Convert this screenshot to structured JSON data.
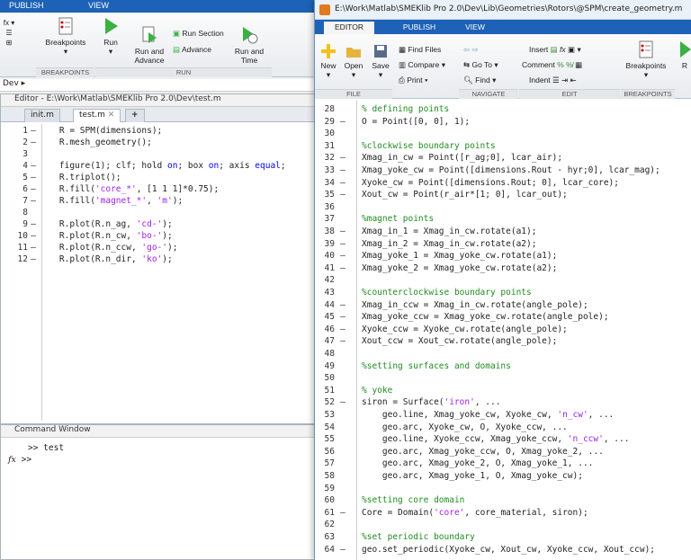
{
  "back_window": {
    "tabs": [
      "PUBLISH",
      "VIEW"
    ],
    "ribbon": {
      "breakpoints_label": "Breakpoints",
      "run_label": "Run",
      "run_and_advance_label": "Run and\nAdvance",
      "run_section_label": "Run Section",
      "advance_label": "Advance",
      "run_and_time_label": "Run and\nTime",
      "group_breakpoints": "BREAKPOINTS",
      "group_run": "RUN"
    },
    "address": "Dev ▸",
    "editor": {
      "title": "Editor - E:\\Work\\Matlab\\SMEKlib Pro 2.0\\Dev\\test.m",
      "tabs": [
        "init.m",
        "test.m",
        "+"
      ],
      "lines": [
        {
          "n": "1",
          "t": "    R = SPM(dimensions);"
        },
        {
          "n": "2",
          "t": "    R.mesh_geometry();"
        },
        {
          "n": "3",
          "t": ""
        },
        {
          "n": "4",
          "t": "    figure(1); clf; hold on; box on; axis equal;"
        },
        {
          "n": "5",
          "t": "    R.triplot();"
        },
        {
          "n": "6",
          "t": "    R.fill('core_*', [1 1 1]*0.75);"
        },
        {
          "n": "7",
          "t": "    R.fill('magnet_*', 'm');"
        },
        {
          "n": "8",
          "t": ""
        },
        {
          "n": "9",
          "t": "    R.plot(R.n_ag, 'cd-');"
        },
        {
          "n": "10",
          "t": "    R.plot(R.n_cw, 'bo-');"
        },
        {
          "n": "11",
          "t": "    R.plot(R.n_ccw, 'go-');"
        },
        {
          "n": "12",
          "t": "    R.plot(R.n_dir, 'ko');"
        }
      ]
    },
    "command_window": {
      "title": "Command Window",
      "line1": ">> test",
      "line2": ">>",
      "fx": "fx"
    }
  },
  "front_window": {
    "title": "E:\\Work\\Matlab\\SMEKlib Pro 2.0\\Dev\\Lib\\Geometries\\Rotors\\@SPM\\create_geometry.m",
    "tabs": [
      "EDITOR",
      "PUBLISH",
      "VIEW"
    ],
    "ribbon": {
      "new": "New",
      "open": "Open",
      "save": "Save",
      "find_files": "Find Files",
      "compare": "Compare",
      "print": "Print",
      "go_to": "Go To",
      "find": "Find",
      "insert": "Insert",
      "comment": "Comment",
      "indent": "Indent",
      "breakpoints": "Breakpoints",
      "run_partial": "R",
      "group_file": "FILE",
      "group_navigate": "NAVIGATE",
      "group_edit": "EDIT",
      "group_breakpoints": "BREAKPOINTS"
    },
    "code": [
      {
        "n": "28",
        "d": "",
        "t": "% defining points",
        "c": "cmt"
      },
      {
        "n": "29",
        "d": "–",
        "t": "O = Point([0, 0], 1);",
        "c": ""
      },
      {
        "n": "30",
        "d": "",
        "t": "",
        "c": ""
      },
      {
        "n": "31",
        "d": "",
        "t": "%clockwise boundary points",
        "c": "cmt"
      },
      {
        "n": "32",
        "d": "–",
        "t": "Xmag_in_cw = Point([r_ag;0], lcar_air);",
        "c": ""
      },
      {
        "n": "33",
        "d": "–",
        "t": "Xmag_yoke_cw = Point([dimensions.Rout - hyr;0], lcar_mag);",
        "c": ""
      },
      {
        "n": "34",
        "d": "–",
        "t": "Xyoke_cw = Point([dimensions.Rout; 0], lcar_core);",
        "c": ""
      },
      {
        "n": "35",
        "d": "–",
        "t": "Xout_cw = Point(r_air*[1; 0], lcar_out);",
        "c": ""
      },
      {
        "n": "36",
        "d": "",
        "t": "",
        "c": ""
      },
      {
        "n": "37",
        "d": "",
        "t": "%magnet points",
        "c": "cmt"
      },
      {
        "n": "38",
        "d": "–",
        "t": "Xmag_in_1 = Xmag_in_cw.rotate(a1);",
        "c": ""
      },
      {
        "n": "39",
        "d": "–",
        "t": "Xmag_in_2 = Xmag_in_cw.rotate(a2);",
        "c": ""
      },
      {
        "n": "40",
        "d": "–",
        "t": "Xmag_yoke_1 = Xmag_yoke_cw.rotate(a1);",
        "c": ""
      },
      {
        "n": "41",
        "d": "–",
        "t": "Xmag_yoke_2 = Xmag_yoke_cw.rotate(a2);",
        "c": ""
      },
      {
        "n": "42",
        "d": "",
        "t": "",
        "c": ""
      },
      {
        "n": "43",
        "d": "",
        "t": "%counterclockwise boundary points",
        "c": "cmt"
      },
      {
        "n": "44",
        "d": "–",
        "t": "Xmag_in_ccw = Xmag_in_cw.rotate(angle_pole);",
        "c": ""
      },
      {
        "n": "45",
        "d": "–",
        "t": "Xmag_yoke_ccw = Xmag_yoke_cw.rotate(angle_pole);",
        "c": ""
      },
      {
        "n": "46",
        "d": "–",
        "t": "Xyoke_ccw = Xyoke_cw.rotate(angle_pole);",
        "c": ""
      },
      {
        "n": "47",
        "d": "–",
        "t": "Xout_ccw = Xout_cw.rotate(angle_pole);",
        "c": ""
      },
      {
        "n": "48",
        "d": "",
        "t": "",
        "c": ""
      },
      {
        "n": "49",
        "d": "",
        "t": "%setting surfaces and domains",
        "c": "cmt"
      },
      {
        "n": "50",
        "d": "",
        "t": "",
        "c": ""
      },
      {
        "n": "51",
        "d": "",
        "t": "% yoke",
        "c": "cmt"
      },
      {
        "n": "52",
        "d": "–",
        "t": "siron = Surface('iron', ...",
        "c": ""
      },
      {
        "n": "53",
        "d": "",
        "t": "    geo.line, Xmag_yoke_cw, Xyoke_cw, 'n_cw', ...",
        "c": ""
      },
      {
        "n": "54",
        "d": "",
        "t": "    geo.arc, Xyoke_cw, O, Xyoke_ccw, ...",
        "c": ""
      },
      {
        "n": "55",
        "d": "",
        "t": "    geo.line, Xyoke_ccw, Xmag_yoke_ccw, 'n_ccw', ...",
        "c": ""
      },
      {
        "n": "56",
        "d": "",
        "t": "    geo.arc, Xmag_yoke_ccw, O, Xmag_yoke_2, ...",
        "c": ""
      },
      {
        "n": "57",
        "d": "",
        "t": "    geo.arc, Xmag_yoke_2, O, Xmag_yoke_1, ...",
        "c": ""
      },
      {
        "n": "58",
        "d": "",
        "t": "    geo.arc, Xmag_yoke_1, O, Xmag_yoke_cw);",
        "c": ""
      },
      {
        "n": "59",
        "d": "",
        "t": "",
        "c": ""
      },
      {
        "n": "60",
        "d": "",
        "t": "%setting core domain",
        "c": "cmt"
      },
      {
        "n": "61",
        "d": "–",
        "t": "Core = Domain('core', core_material, siron);",
        "c": ""
      },
      {
        "n": "62",
        "d": "",
        "t": "",
        "c": ""
      },
      {
        "n": "63",
        "d": "",
        "t": "%set periodic boundary",
        "c": "cmt"
      },
      {
        "n": "64",
        "d": "–",
        "t": "geo.set_periodic(Xyoke_cw, Xout_cw, Xyoke_ccw, Xout_ccw);",
        "c": ""
      }
    ]
  }
}
